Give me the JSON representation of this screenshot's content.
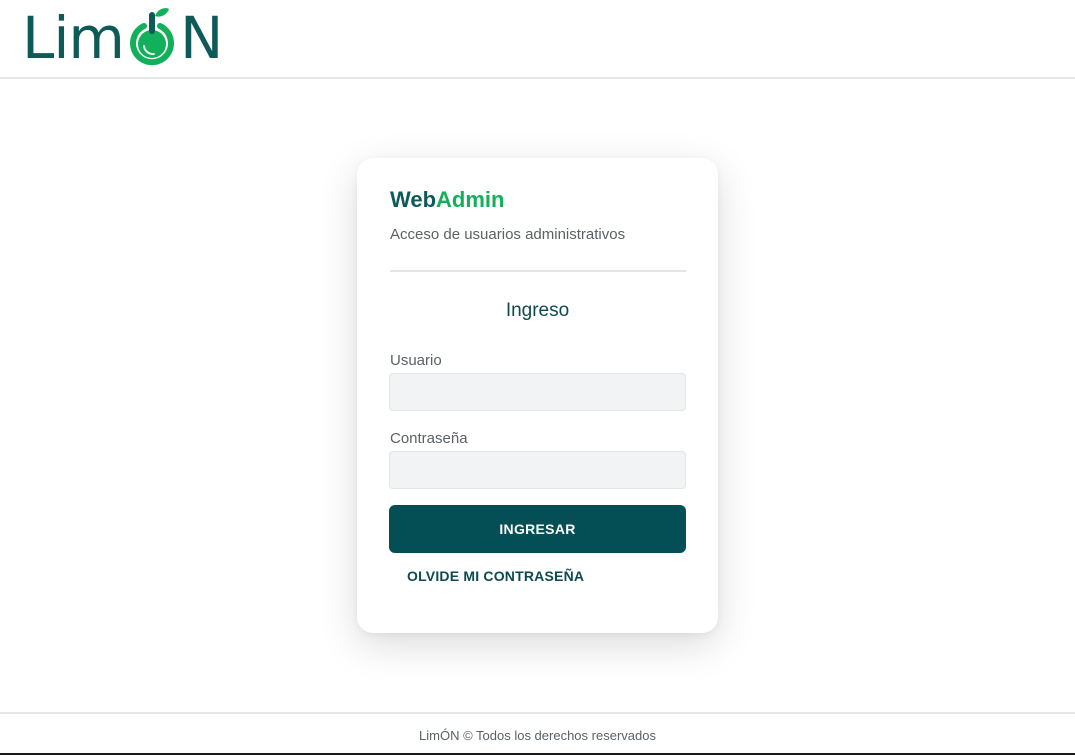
{
  "header": {
    "logo": {
      "text_before": "Lim",
      "text_o": "Ó",
      "text_after": "N",
      "icon": "power-lemon-icon",
      "colors": {
        "dark": "#0e5a58",
        "accent": "#12b05a"
      }
    }
  },
  "card": {
    "brand_web": "Web",
    "brand_admin": "Admin",
    "subtitle": "Acceso de usuarios administrativos",
    "form_title": "Ingreso",
    "username_label": "Usuario",
    "username_value": "",
    "password_label": "Contraseña",
    "password_value": "",
    "submit_label": "INGRESAR",
    "forgot_label": "OLVIDE MI CONTRASEÑA"
  },
  "footer": {
    "text": "LimÓN © Todos los derechos reservados"
  },
  "colors": {
    "primary": "#044f55",
    "brand_green": "#12b05a",
    "brand_dark": "#0e5a58"
  }
}
